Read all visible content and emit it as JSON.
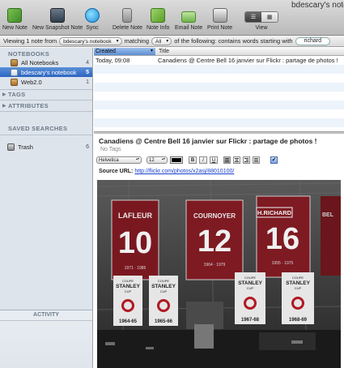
{
  "window": {
    "title": "bdescary's noteb"
  },
  "toolbar": {
    "items": [
      {
        "label": "New Note",
        "icon": "new-note-icon"
      },
      {
        "label": "New Snapshot Note",
        "icon": "camera-icon"
      },
      {
        "label": "Sync",
        "icon": "sync-icon"
      },
      {
        "label": "Delete Note",
        "icon": "trash-icon"
      },
      {
        "label": "Note Info",
        "icon": "info-icon"
      },
      {
        "label": "Email Note",
        "icon": "email-icon"
      },
      {
        "label": "Print Note",
        "icon": "printer-icon"
      }
    ],
    "view_label": "View"
  },
  "filter": {
    "prefix": "Viewing 1 note from",
    "notebook": "bdescary's notebook",
    "matching": "matching",
    "mode": "All",
    "suffix": "of the following: contains words starting with",
    "query": "richard"
  },
  "sidebar": {
    "notebooks_header": "NOTEBOOKS",
    "notebooks": [
      {
        "label": "All Notebooks",
        "count": "4"
      },
      {
        "label": "bdescary's notebook",
        "count": "5",
        "selected": true
      },
      {
        "label": "Web2.0",
        "count": "1"
      }
    ],
    "tags_header": "TAGS",
    "attributes_header": "ATTRIBUTES",
    "saved_searches_header": "SAVED SEARCHES",
    "trash": {
      "label": "Trash",
      "count": "6"
    },
    "activity_header": "ACTIVITY"
  },
  "note_list": {
    "columns": [
      "Created",
      "Title"
    ],
    "rows": [
      {
        "created": "Today, 09:08",
        "title": "Canadiens @ Centre Bell 16 janvier sur Flickr : partage de photos !"
      }
    ]
  },
  "note": {
    "title": "Canadiens @ Centre Bell 16 janvier sur Flickr : partage de photos !",
    "tags": "No Tags",
    "format": {
      "font": "Helvetica",
      "size": "12"
    },
    "source_label": "Source URL:",
    "source_url": "http://flickr.com/photos/x2asj/88010100/"
  },
  "photo": {
    "banners": [
      {
        "name": "LAFLEUR",
        "number": "10",
        "years": "1971 · 1985"
      },
      {
        "name": "COURNOYER",
        "number": "12",
        "years": "1964 · 1979"
      },
      {
        "name": "H.RICHARD",
        "number": "16",
        "years": "1955 · 1975"
      },
      {
        "name": "BEL",
        "number": "",
        "years": ""
      }
    ],
    "cups": [
      {
        "line1": "COUPE",
        "line2": "STANLEY",
        "line3": "CUP",
        "years": "1964-65"
      },
      {
        "line1": "COUPE",
        "line2": "STANLEY",
        "line3": "CUP",
        "years": "1965-66"
      },
      {
        "line1": "COUPE",
        "line2": "STANLEY",
        "line3": "CUP",
        "years": "1967-68"
      },
      {
        "line1": "COUPE",
        "line2": "STANLEY",
        "line3": "CUP",
        "years": "1968-69"
      }
    ]
  },
  "colors": {
    "selection": "#2d65c0",
    "sidebar": "#dde4ec",
    "banner_red": "#8a1a22",
    "cup_white": "#ececec"
  }
}
